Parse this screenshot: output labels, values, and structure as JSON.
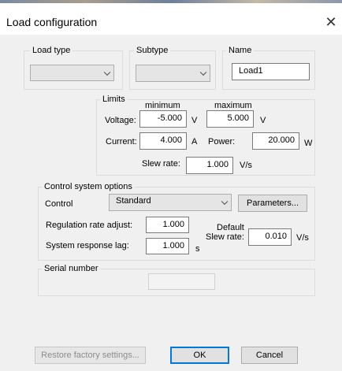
{
  "window": {
    "title": "Load configuration"
  },
  "load_type": {
    "label": "Load type",
    "value": ""
  },
  "subtype": {
    "label": "Subtype",
    "value": ""
  },
  "name": {
    "label": "Name",
    "value": "Load1"
  },
  "limits": {
    "label": "Limits",
    "minimum_header": "minimum",
    "maximum_header": "maximum",
    "voltage": {
      "label": "Voltage:",
      "min": "-5.000",
      "min_unit": "V",
      "max": "5.000",
      "max_unit": "V"
    },
    "current": {
      "label": "Current:",
      "value": "4.000",
      "unit": "A"
    },
    "power": {
      "label": "Power:",
      "value": "20.000",
      "unit": "W"
    },
    "slew_rate": {
      "label": "Slew rate:",
      "value": "1.000",
      "unit": "V/s"
    }
  },
  "control_system": {
    "label": "Control system options",
    "control_label": "Control",
    "control_value": "Standard",
    "parameters_button": "Parameters...",
    "regulation_rate": {
      "label": "Regulation rate adjust:",
      "value": "1.000"
    },
    "response_lag": {
      "label": "System response lag:",
      "value": "1.000",
      "unit": "s"
    },
    "default_slew": {
      "label_line1": "Default",
      "label_line2": "Slew rate:",
      "value": "0.010",
      "unit": "V/s"
    }
  },
  "serial_number": {
    "label": "Serial number",
    "value": ""
  },
  "buttons": {
    "restore": "Restore factory settings...",
    "ok": "OK",
    "cancel": "Cancel"
  },
  "icons": {
    "close": "close-icon",
    "dropdown": "chevron-down-icon"
  }
}
